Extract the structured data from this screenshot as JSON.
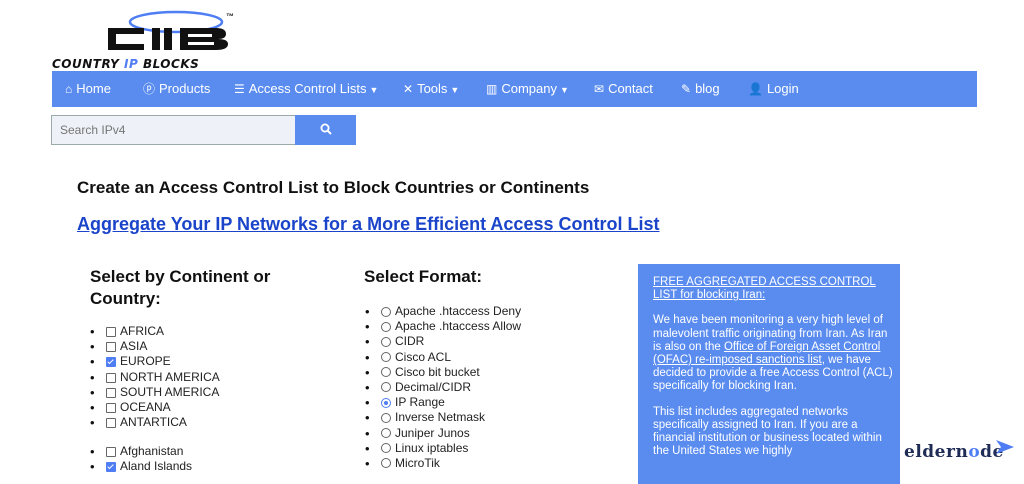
{
  "logo": {
    "text_part1": "COUNTRY ",
    "text_part2": "IP",
    "text_part3": " BLOCKS",
    "trademark": "™"
  },
  "nav": [
    {
      "label": "Home",
      "icon": "home-icon"
    },
    {
      "label": "Products",
      "icon": "products-icon"
    },
    {
      "label": "Access Control Lists",
      "icon": "list-icon",
      "dropdown": true
    },
    {
      "label": "Tools",
      "icon": "tools-icon",
      "dropdown": true
    },
    {
      "label": "Company",
      "icon": "building-icon",
      "dropdown": true
    },
    {
      "label": "Contact",
      "icon": "envelope-icon"
    },
    {
      "label": "blog",
      "icon": "blog-icon"
    },
    {
      "label": "Login",
      "icon": "user-icon"
    }
  ],
  "search": {
    "placeholder": "Search IPv4",
    "button_icon": "search-icon"
  },
  "page": {
    "title": "Create an Access Control List to Block Countries or Continents",
    "link": "Aggregate Your IP Networks for a More Efficient Access Control List"
  },
  "continent_section": {
    "heading": "Select by Continent or Country:",
    "continents": [
      {
        "label": "AFRICA",
        "checked": false
      },
      {
        "label": "ASIA",
        "checked": false
      },
      {
        "label": "EUROPE",
        "checked": true
      },
      {
        "label": "NORTH AMERICA",
        "checked": false
      },
      {
        "label": "SOUTH AMERICA",
        "checked": false
      },
      {
        "label": "OCEANA",
        "checked": false
      },
      {
        "label": "ANTARTICA",
        "checked": false
      }
    ],
    "countries": [
      {
        "label": "Afghanistan",
        "checked": false
      },
      {
        "label": "Aland Islands",
        "checked": true
      }
    ]
  },
  "format_section": {
    "heading": "Select Format:",
    "formats": [
      {
        "label": "Apache .htaccess Deny",
        "selected": false
      },
      {
        "label": "Apache .htaccess Allow",
        "selected": false
      },
      {
        "label": "CIDR",
        "selected": false
      },
      {
        "label": "Cisco ACL",
        "selected": false
      },
      {
        "label": "Cisco bit bucket",
        "selected": false
      },
      {
        "label": "Decimal/CIDR",
        "selected": false
      },
      {
        "label": "IP Range",
        "selected": true
      },
      {
        "label": "Inverse Netmask",
        "selected": false
      },
      {
        "label": "Juniper Junos",
        "selected": false
      },
      {
        "label": "Linux iptables",
        "selected": false
      },
      {
        "label": "MicroTik",
        "selected": false
      }
    ]
  },
  "panel": {
    "link_title": "FREE AGGREGATED ACCESS CONTROL LIST for blocking Iran:",
    "p2_a": "We have been monitoring a very high level of malevolent traffic originating from Iran. As Iran is also on the ",
    "p2_link": "Office of Foreign Asset Control (OFAC) re-imposed sanctions list",
    "p2_b": ", we have decided to provide a free Access Control (ACL) specifically for blocking Iran.",
    "p3": "This list includes aggregated networks specifically assigned to Iran. If you are a financial institution or business located within the United States we highly"
  },
  "watermark": {
    "part1": "elder",
    "part2": "n",
    "part3": "o",
    "part4": "de"
  },
  "colors": {
    "accent": "#5a8cf0",
    "link": "#1a44c9"
  }
}
